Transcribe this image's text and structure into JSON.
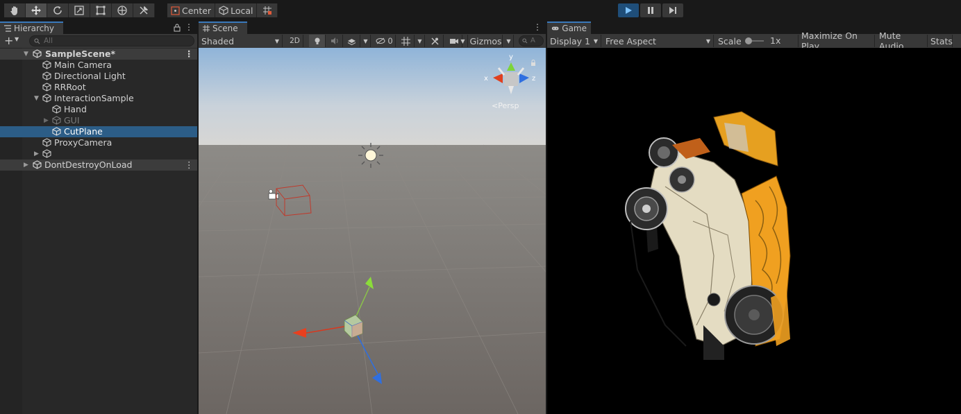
{
  "toolbar": {
    "tools": [
      "hand-icon",
      "move-icon",
      "rotate-icon",
      "scale-icon",
      "rect-icon",
      "transform-icon",
      "custom-tool-icon"
    ],
    "pivot_label": "Center",
    "space_label": "Local",
    "play_icon": "play-icon",
    "pause_icon": "pause-icon",
    "step_icon": "step-icon"
  },
  "hierarchy": {
    "tab_label": "Hierarchy",
    "search_placeholder": "All",
    "scene_name": "SampleScene*",
    "items": [
      {
        "label": "Main Camera",
        "depth": 1
      },
      {
        "label": "Directional Light",
        "depth": 1
      },
      {
        "label": "RRRoot",
        "depth": 1
      },
      {
        "label": "InteractionSample",
        "depth": 1
      },
      {
        "label": "Hand",
        "depth": 2
      },
      {
        "label": "GUI",
        "depth": 2
      },
      {
        "label": "CutPlane",
        "depth": 2
      },
      {
        "label": "ProxyCamera",
        "depth": 1
      },
      {
        "label": "",
        "depth": 1
      }
    ],
    "dont_destroy": "DontDestroyOnLoad"
  },
  "scene": {
    "tab_label": "Scene",
    "shading_mode": "Shaded",
    "mode_2d": "2D",
    "hidden_count": "0",
    "gizmos_label": "Gizmos",
    "search_placeholder": "A",
    "persp_label": "Persp",
    "axis_x": "x",
    "axis_y": "y",
    "axis_z": "z"
  },
  "game": {
    "tab_label": "Game",
    "display": "Display 1",
    "aspect": "Free Aspect",
    "scale_label": "Scale",
    "scale_value": "1x",
    "maximize": "Maximize On Play",
    "mute": "Mute Audio",
    "stats": "Stats"
  },
  "colors": {
    "accent_blue": "#3a79bb",
    "selection": "#2c5d87",
    "engine_orange": "#f0a020",
    "engine_cream": "#e8e0c4"
  }
}
